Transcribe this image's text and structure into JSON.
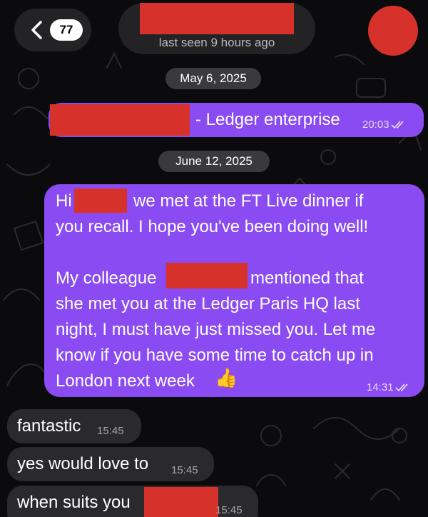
{
  "header": {
    "unread_count": "77",
    "status": "last seen 9 hours ago"
  },
  "dates": [
    "May 6, 2025",
    "June 12, 2025"
  ],
  "messages": {
    "m1": {
      "text": "- Ledger enterprise",
      "time": "20:03"
    },
    "m2": {
      "line1_a": "Hi",
      "line1_b": "we met at the FT Live dinner if",
      "line2": "you recall. I hope you've been doing well!",
      "line3_a": "My colleague",
      "line3_b": "mentioned that",
      "line4": "she met you at the Ledger Paris HQ last",
      "line5": "night, I must have just missed you. Let me",
      "line6": "know if you have some time to catch up in",
      "line7": "London next week",
      "emoji": "👍",
      "time": "14:31"
    },
    "m3": {
      "text": "fantastic",
      "time": "15:45"
    },
    "m4": {
      "text": "yes would love to",
      "time": "15:45"
    },
    "m5": {
      "text": "when suits you",
      "time": "15:45"
    }
  },
  "colors": {
    "outgoing_bubble": "#8a4cf2",
    "incoming_bubble": "#2a2a2c",
    "redaction": "#d6312b",
    "background": "#0b0b0d"
  },
  "icons": [
    "chevron-left-icon",
    "double-check-icon"
  ]
}
